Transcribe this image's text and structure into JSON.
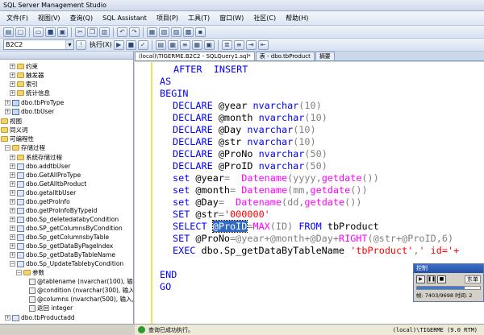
{
  "window": {
    "title": "SQL Server Management Studio"
  },
  "menu": [
    "文件(F)",
    "视图(V)",
    "查询(Q)",
    "SQL Assistant",
    "项目(P)",
    "工具(T)",
    "窗口(W)",
    "社区(C)",
    "帮助(H)"
  ],
  "toolbar": {
    "database": "B2C2",
    "execute_label": "执行(X)"
  },
  "tabs": [
    "(local)\\TIGERME.B2C2 - SQLQuery1.sql*",
    "表 - dbo.tbProduct",
    "摘要"
  ],
  "explorer": {
    "items": [
      "约束",
      "触发器",
      "索引",
      "统计信息",
      "dbo.tbProType",
      "dbo.tbUser",
      "视图",
      "同义词",
      "可编程性",
      "存储过程",
      "系统存储过程",
      "dbo.addtbUser",
      "dbo.GetAllProType",
      "dbo.GetAlltbProduct",
      "dbo.getalltbUser",
      "dbo.getProInfo",
      "dbo.getProInfoByTypeid",
      "dbo.Sp_deletedatabyCondition",
      "dbo.SP_getColumnsByCondition",
      "dbo.Sp_getColumnsbyTable",
      "dbo.Sp_getDataByPageIndex",
      "dbo.Sp_getDataByTableName",
      "dbo.Sp_UpdateTablebyCondition",
      "参数",
      "@tablename (nvarchar(100), 输入,",
      "@condition (nvarchar(300), 输入, 3",
      "@columns (nvarchar(500), 输入, 无",
      "返回 integer",
      "dbo.tbProductadd"
    ]
  },
  "code": {
    "l1_kw1": "AFTER",
    "l1_kw2": "INSERT",
    "l2": "AS",
    "l3": "BEGIN",
    "declare": "DECLARE",
    "nvarchar": "nvarchar",
    "set": "set",
    "SET": "SET",
    "v_year": "@year",
    "v_month": "@month",
    "v_day": "@Day",
    "v_str": "@str",
    "v_prono": "@ProNo",
    "v_proid": "@ProID",
    "p10": "(10)",
    "p50": "(50)",
    "datename": "Datename",
    "yyyy": "(yyyy,",
    "mm": "(mm,",
    "dd": "(dd,",
    "getdate": "getdate",
    "close": "())",
    "close2": "()",
    "eq": "=",
    "eqsp": "= ",
    "eq_year": "=  ",
    "eq_day": "=  ",
    "zeros": "'000000'",
    "select": "SELECT",
    "sel_text": "@ProID",
    "max": "MAX",
    "max_arg": "(ID)",
    "from": "FROM",
    "tbl": "tbProduct",
    "set2_rest": "=@year+@month+@Day+",
    "right": "RIGHT",
    "right_args": "(@str+@ProID,6)",
    "exec": "EXEC",
    "exec_proc": "dbo.Sp_getDataByTableName",
    "exec_s1": "'tbProduct'",
    "exec_comma": ",",
    "exec_s2": "' id='+",
    "end": "END",
    "go": "GO"
  },
  "float_window": {
    "title": "控制",
    "right_btn": "东单",
    "status": "帧: 7403/9698 时间: 2",
    "progress": 0.76
  },
  "status": {
    "message": "查询已成功执行。",
    "server": "(local)\\TIGERME (9.0 RTM)"
  }
}
